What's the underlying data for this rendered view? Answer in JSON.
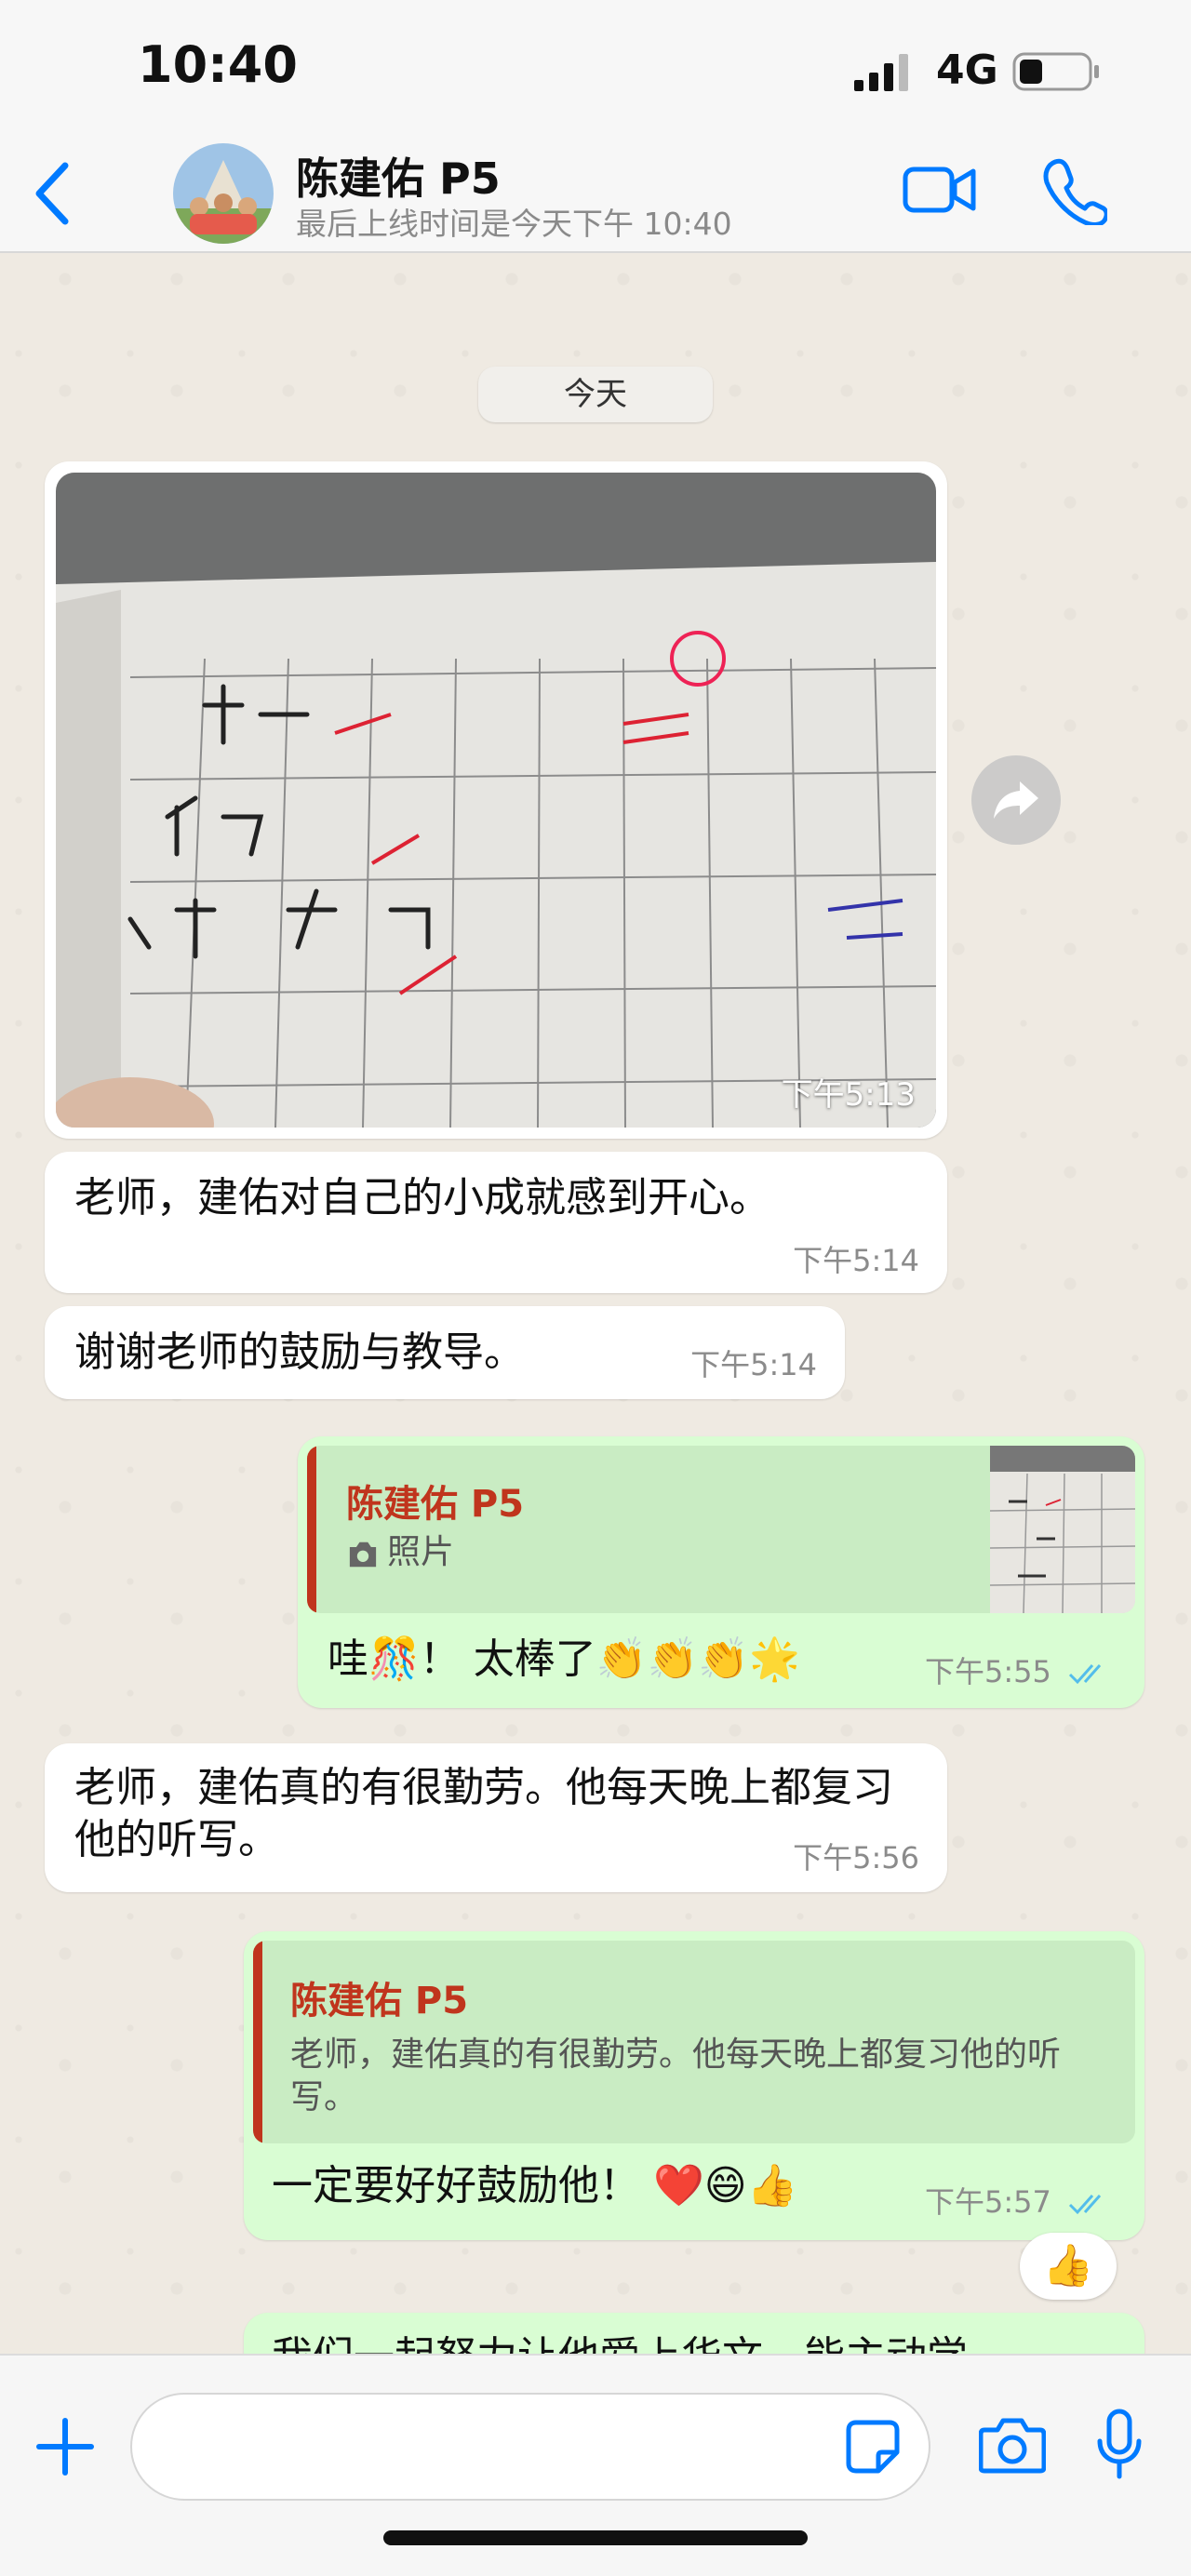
{
  "status_bar": {
    "time": "10:40",
    "network": "4G"
  },
  "header": {
    "contact_name": "陈建佑 P5",
    "contact_status": "最后上线时间是今天下午 10:40"
  },
  "day_separator": "今天",
  "messages": [
    {
      "type": "photo",
      "direction": "in",
      "time": "下午5:13"
    },
    {
      "type": "text",
      "direction": "in",
      "text": "老师，建佑对自己的小成就感到开心。",
      "time": "下午5:14"
    },
    {
      "type": "text",
      "direction": "in",
      "text": "谢谢老师的鼓励与教导。",
      "time": "下午5:14"
    },
    {
      "type": "reply",
      "direction": "out",
      "quote_name": "陈建佑 P5",
      "quote_text": "照片",
      "text": "哇🎊！ 太棒了👏👏👏🌟",
      "time": "下午5:55"
    },
    {
      "type": "text",
      "direction": "in",
      "text": "老师，建佑真的有很勤劳。他每天晚上都复习他的听写。",
      "time": "下午5:56"
    },
    {
      "type": "reply",
      "direction": "out",
      "quote_name": "陈建佑 P5",
      "quote_text": "老师，建佑真的有很勤劳。他每天晚上都复习他的听写。",
      "text": "一定要好好鼓励他！ ❤️😄👍",
      "time": "下午5:57",
      "reaction": "👍"
    },
    {
      "type": "text",
      "direction": "out",
      "text": "我们一起努力让他爱上华文，能主动学"
    }
  ],
  "colors": {
    "accent": "#007aff",
    "outgoing": "#d9fdd3",
    "incoming": "#ffffff",
    "quote_name": "#c0351d"
  },
  "icons": [
    "back-icon",
    "video-icon",
    "call-icon",
    "forward-icon",
    "plus-icon",
    "sticker-icon",
    "camera-icon",
    "mic-icon"
  ]
}
